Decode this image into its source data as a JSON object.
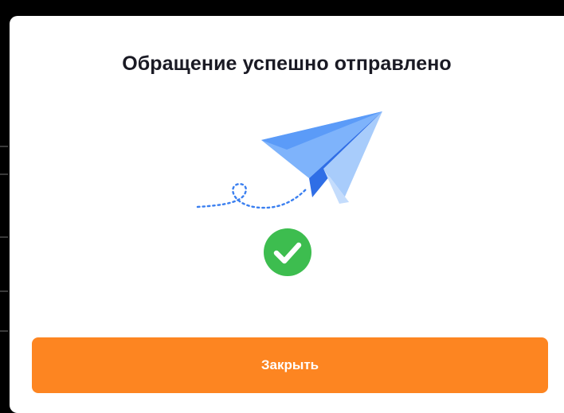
{
  "modal": {
    "title": "Обращение успешно отправлено",
    "close_label": "Закрыть"
  },
  "icons": {
    "illustration": "paper-plane-icon",
    "status": "check-circle-icon"
  },
  "colors": {
    "button": "#fd8521",
    "success": "#3dbd4f",
    "plane": "#3b8cf5",
    "title": "#1a1a24"
  }
}
